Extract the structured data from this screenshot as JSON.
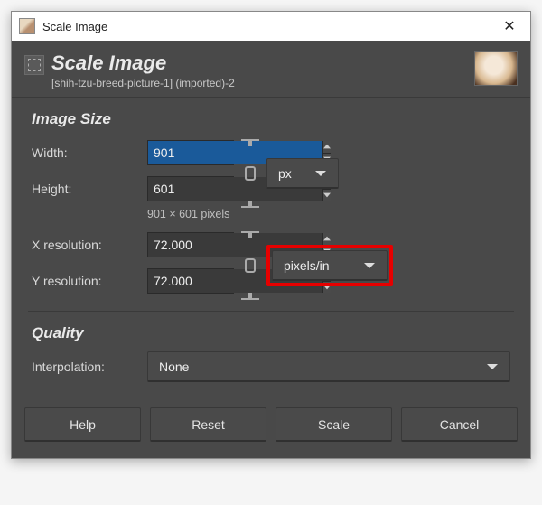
{
  "titlebar": {
    "title": "Scale Image"
  },
  "header": {
    "title": "Scale Image",
    "subtitle": "[shih-tzu-breed-picture-1] (imported)-2"
  },
  "imageSize": {
    "section_label": "Image Size",
    "width_label": "Width:",
    "height_label": "Height:",
    "width_value": "901",
    "height_value": "601",
    "hint": "901 × 601 pixels",
    "unit": "px",
    "xres_label": "X resolution:",
    "yres_label": "Y resolution:",
    "xres_value": "72.000",
    "yres_value": "72.000",
    "res_unit": "pixels/in"
  },
  "quality": {
    "section_label": "Quality",
    "interp_label": "Interpolation:",
    "interp_value": "None"
  },
  "buttons": {
    "help": "Help",
    "reset": "Reset",
    "scale": "Scale",
    "cancel": "Cancel"
  }
}
